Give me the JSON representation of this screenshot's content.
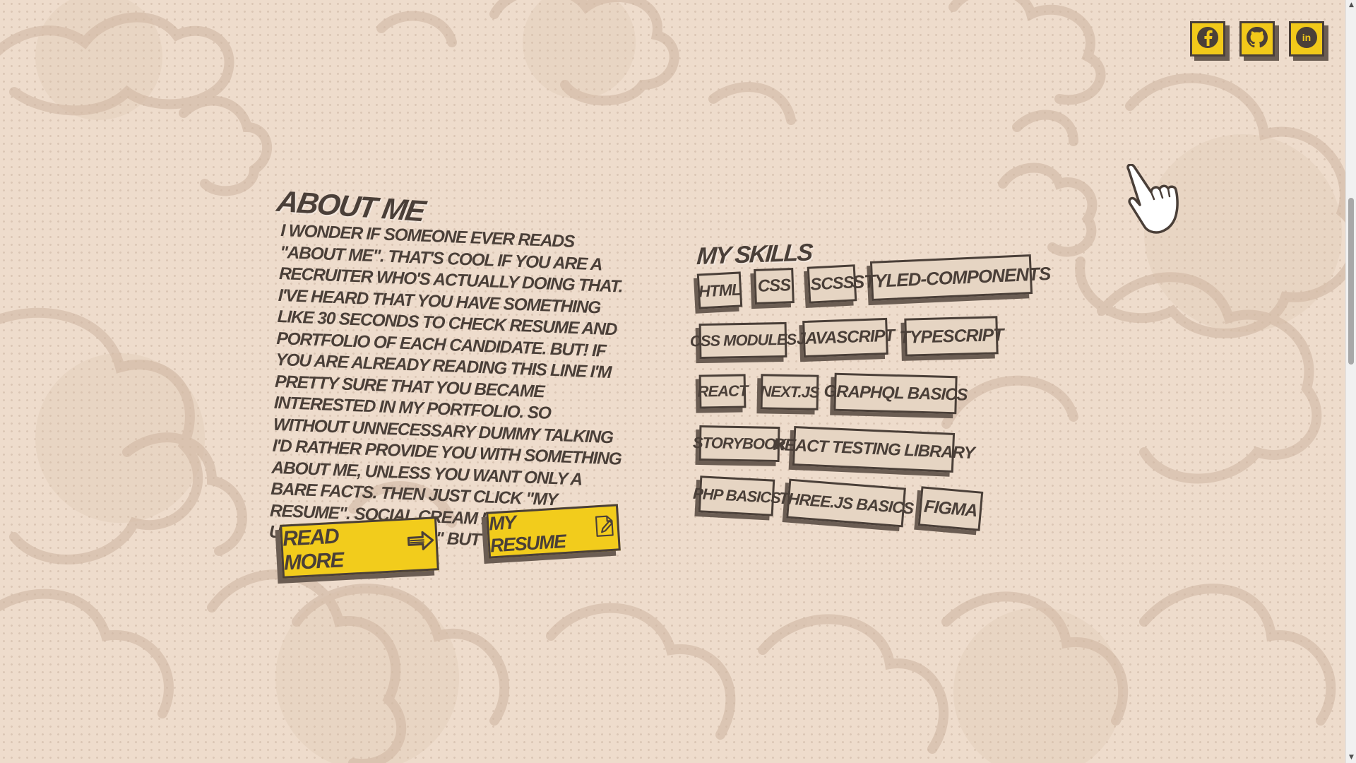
{
  "social": [
    {
      "name": "facebook",
      "icon": "facebook-icon"
    },
    {
      "name": "github",
      "icon": "github-icon"
    },
    {
      "name": "linkedin",
      "icon": "linkedin-icon",
      "text": "in"
    }
  ],
  "about": {
    "title": "About me",
    "text": "I wonder if someone ever reads \"About me\". That's cool if you are a recruiter who's actually doing that. I've heard that you have something like 30 seconds to check resume and portfolio of each candidate. But! If you are already reading this line I'm pretty sure that you became interested in my portfolio. So without unnecessary dummy talking I'd rather provide you with something about me, unless you want only a bare facts. Then just click \"My resume\". Social cream is going to be under \"Read more\" button.",
    "read_more_label": "Read more",
    "read_more_icon": "arrow-right-icon",
    "resume_label": "My resume",
    "resume_icon": "document-edit-icon"
  },
  "skills": {
    "title": "My skills",
    "items": [
      "HTML",
      "CSS",
      "SCSS",
      "styled-components",
      "CSS modules",
      "JavaScript",
      "TypeScript",
      "React",
      "Next.js",
      "GraphQL basics",
      "Storybook",
      "React Testing Library",
      "PHP basics",
      "Three.js basics",
      "Figma"
    ]
  },
  "colors": {
    "background": "#eedccc",
    "accent_yellow": "#f2cc1c",
    "ink": "#4a3f38",
    "shadow": "#6b5d53",
    "tag_fill": "#e6d5c3"
  },
  "cursor": {
    "icon": "pointing-hand-icon"
  }
}
